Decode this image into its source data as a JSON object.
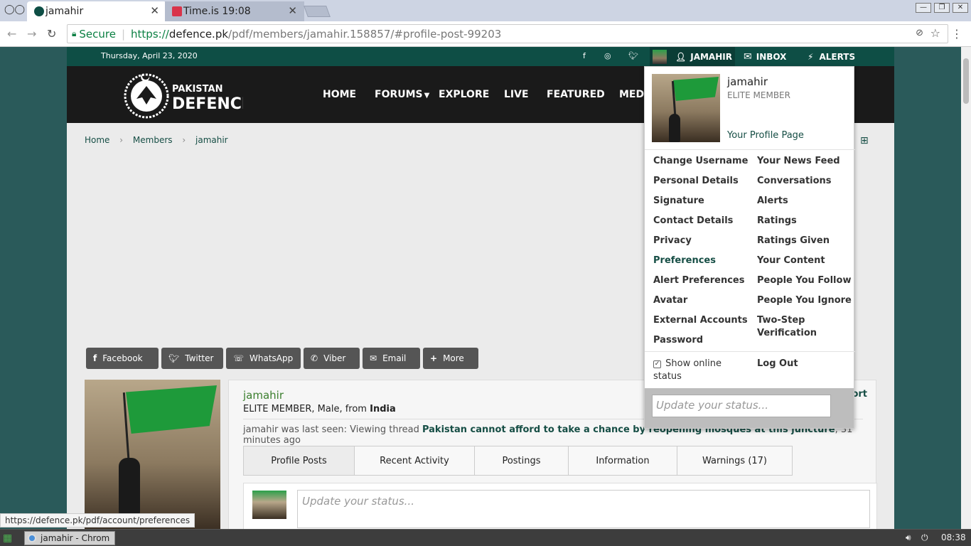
{
  "browser": {
    "tabs": [
      {
        "title": "jamahir",
        "active": true
      },
      {
        "title": "Time.is 19:08",
        "active": false
      }
    ],
    "secure_label": "Secure",
    "url_scheme": "https://",
    "url_host": "defence.pk",
    "url_path": "/pdf/members/jamahir.158857/#profile-post-99203",
    "status_url": "https://defence.pk/pdf/account/preferences"
  },
  "site": {
    "date": "Thursday, April 23, 2020",
    "logo": {
      "line1": "PAKISTAN",
      "line2": "DEFENCE"
    },
    "nav": [
      "HOME",
      "FORUMS",
      "EXPLORE",
      "LIVE",
      "FEATURED",
      "MEDI"
    ],
    "user_bar": {
      "username": "JAMAHIR",
      "inbox": "INBOX",
      "alerts": "ALERTS"
    },
    "breadcrumb": [
      "Home",
      "Members",
      "jamahir"
    ],
    "share": [
      "Facebook",
      "Twitter",
      "WhatsApp",
      "Viber",
      "Email",
      "More"
    ]
  },
  "profile": {
    "name": "jamahir",
    "role": "ELITE MEMBER",
    "gender_prefix": ", Male, from ",
    "country": "India",
    "last_seen_prefix": "jamahir was last seen: Viewing thread ",
    "thread": "Pakistan cannot afford to take a chance by reopening mosques at this juncture",
    "last_seen_suffix": ", 31 minutes ago",
    "report": "ort",
    "tabs": [
      "Profile Posts",
      "Recent Activity",
      "Postings",
      "Information",
      "Warnings (17)"
    ],
    "status_placeholder": "Update your status..."
  },
  "dropdown": {
    "name": "jamahir",
    "role": "ELITE MEMBER",
    "profile_link": "Your Profile Page",
    "left_links": [
      "Change Username",
      "Personal Details",
      "Signature",
      "Contact Details",
      "Privacy",
      "Preferences",
      "Alert Preferences",
      "Avatar",
      "External Accounts",
      "Password"
    ],
    "right_links": [
      "Your News Feed",
      "Conversations",
      "Alerts",
      "Ratings",
      "Ratings Given",
      "Your Content",
      "People You Follow",
      "People You Ignore",
      "Two-Step Verification"
    ],
    "show_online": "Show online status",
    "logout": "Log Out",
    "status_placeholder": "Update your status..."
  },
  "taskbar": {
    "task": "jamahir - Chrom",
    "clock": "08:38"
  }
}
